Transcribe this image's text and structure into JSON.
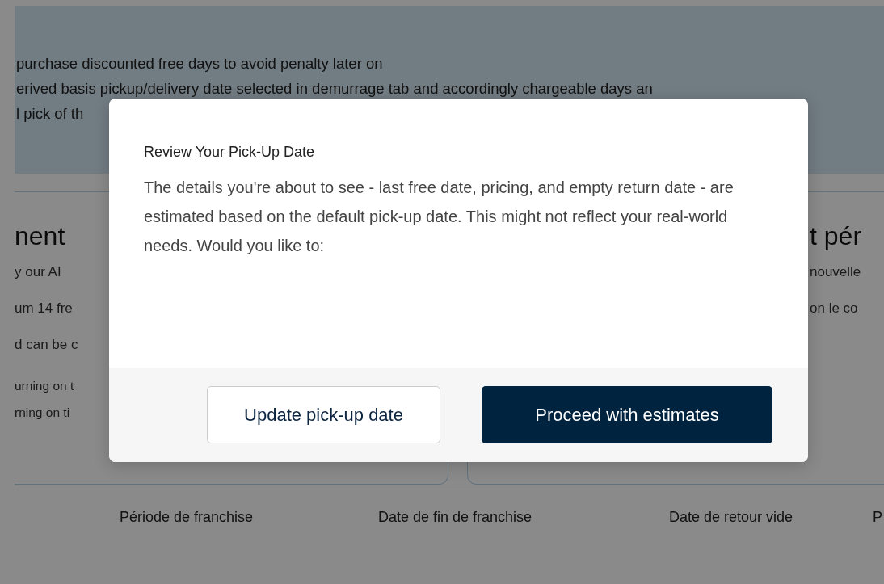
{
  "banner": {
    "lines": [
      "purchase discounted free days to avoid penalty later on",
      "erived basis pickup/delivery date selected in demurrage tab and accordingly chargeable days an",
      "l pick of th"
    ]
  },
  "cards": [
    {
      "heading": "nent",
      "lines": [
        "y our AI",
        "um 14 fre",
        "d can be c"
      ],
      "notes": [
        "urning on t",
        "rning on ti"
      ]
    },
    {
      "heading": "t pér",
      "lines": [
        "nouvelle",
        "on le co"
      ]
    }
  ],
  "table": {
    "columns": [
      "Période de franchise",
      "Date de fin de franchise",
      "Date de retour vide",
      "P"
    ]
  },
  "dialog": {
    "title": "Review Your Pick-Up Date",
    "message": "The details you're about to see - last free date, pricing, and empty return date - are estimated based on the default pick-up date. This might not reflect your real-world needs. Would you like to:",
    "buttons": [
      {
        "label": "Update pick-up date",
        "kind": "secondary"
      },
      {
        "label": "Proceed with estimates",
        "kind": "primary"
      }
    ]
  }
}
